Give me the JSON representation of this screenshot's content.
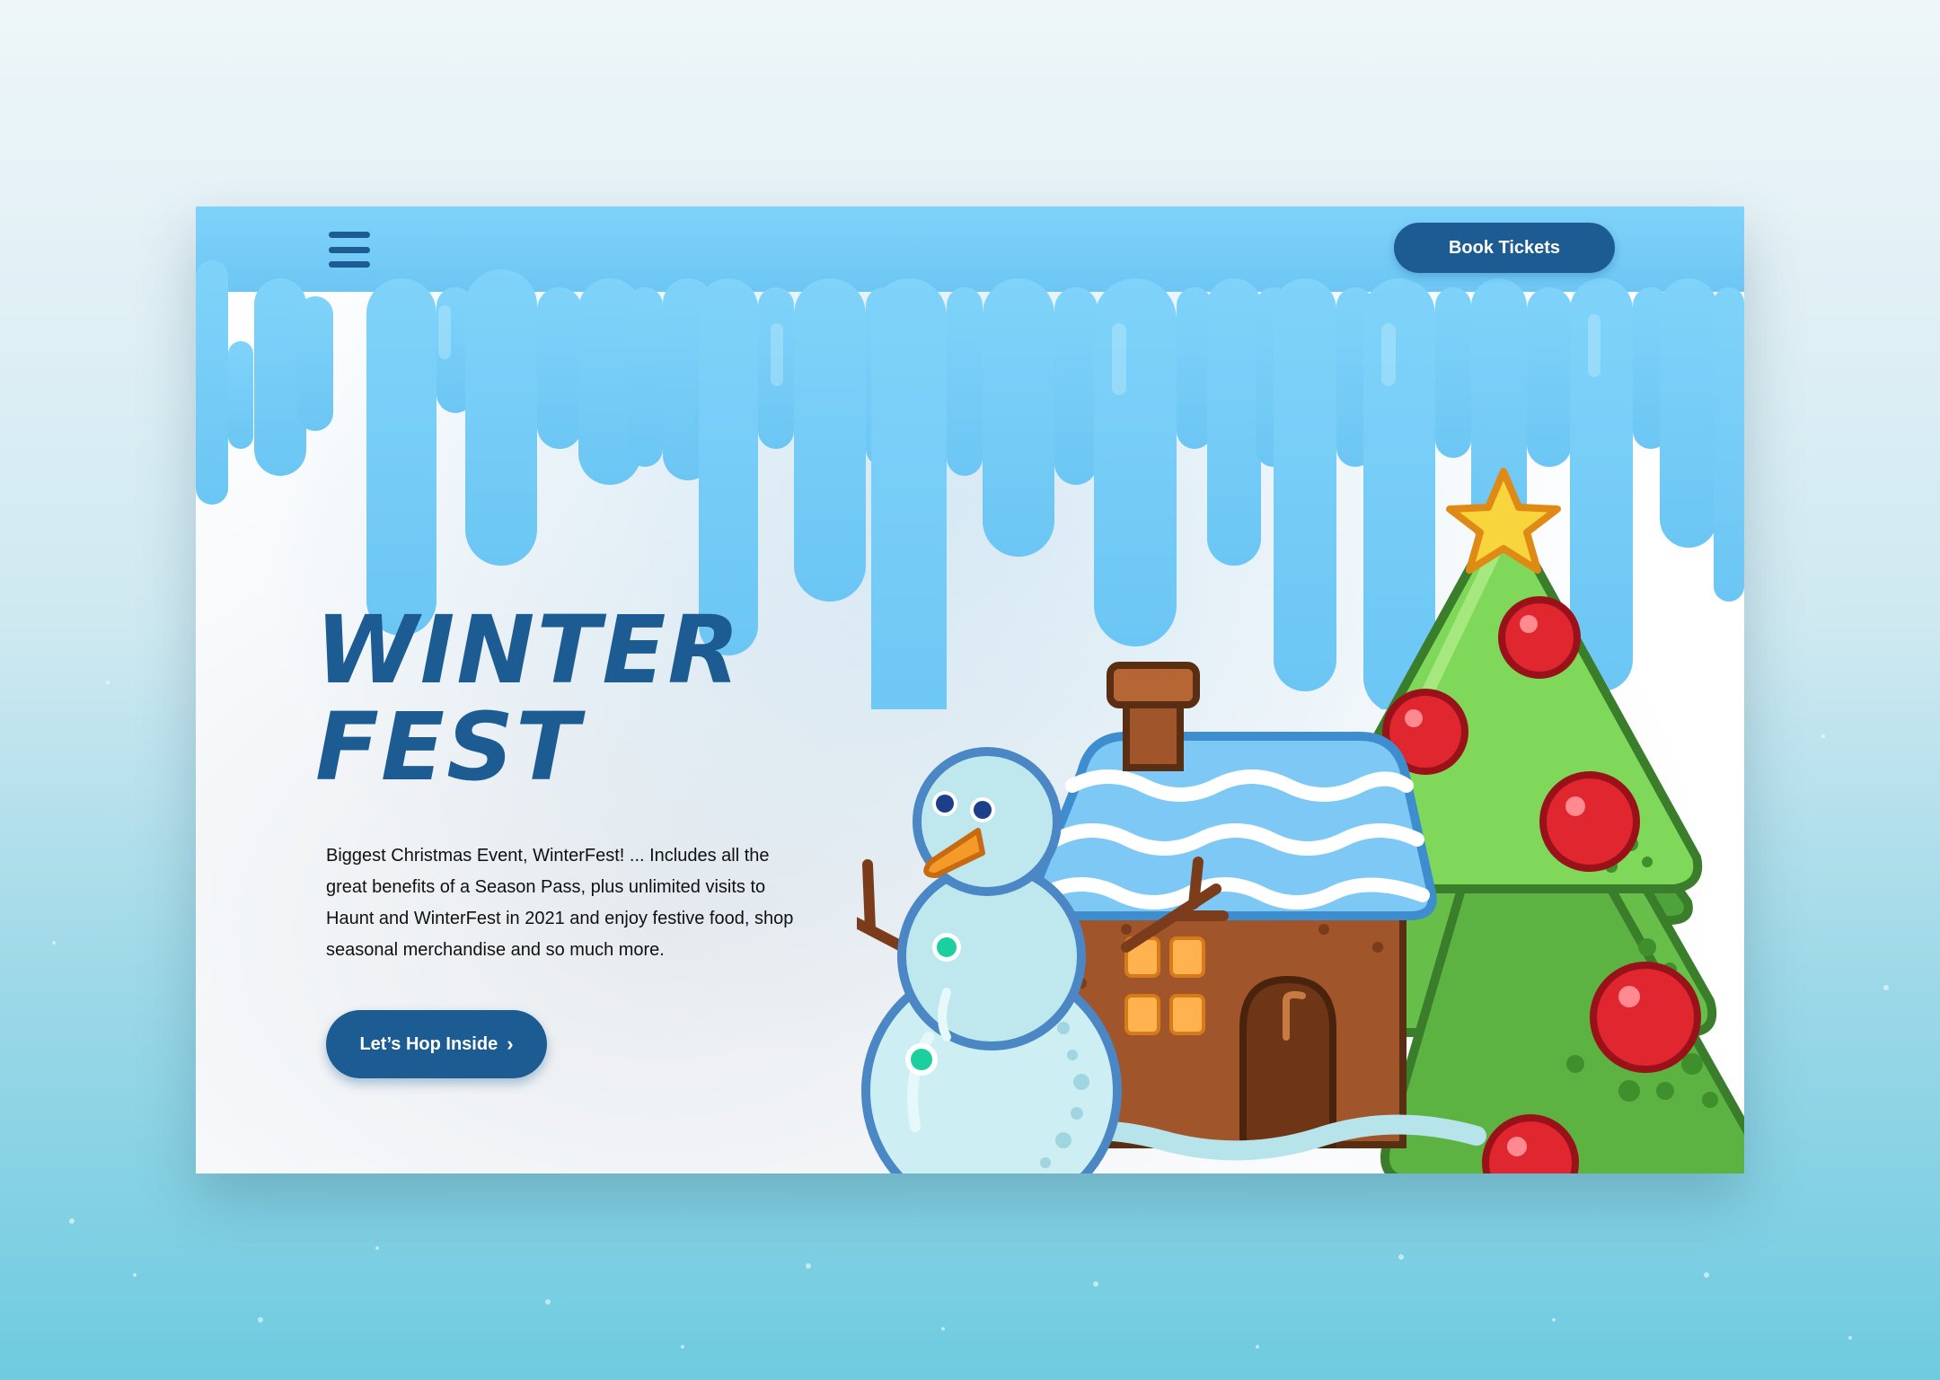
{
  "header": {
    "menu_icon": "hamburger-menu-icon",
    "book_tickets_label": "Book Tickets"
  },
  "hero": {
    "title_line1": "WINTER",
    "title_line2": "FEST",
    "description": "Biggest Christmas Event, WinterFest! ... Includes all the great benefits of a Season Pass, plus unlimited visits to Haunt and WinterFest in 2021 and enjoy festive food, shop seasonal merchandise and so much more.",
    "cta_label": "Let’s Hop Inside",
    "cta_icon": "chevron-right-icon"
  },
  "illustration": {
    "items": [
      "snowman-illustration",
      "gingerbread-house-illustration",
      "christmas-tree-illustration",
      "star-icon",
      "icicle-drips"
    ]
  },
  "colors": {
    "brand": "#1d5c92",
    "ice": "#79cdf7",
    "tree_green": "#7fd85a",
    "ornament_red": "#d9232e",
    "house_brown": "#a0552b",
    "star_yellow": "#f8d53c"
  }
}
